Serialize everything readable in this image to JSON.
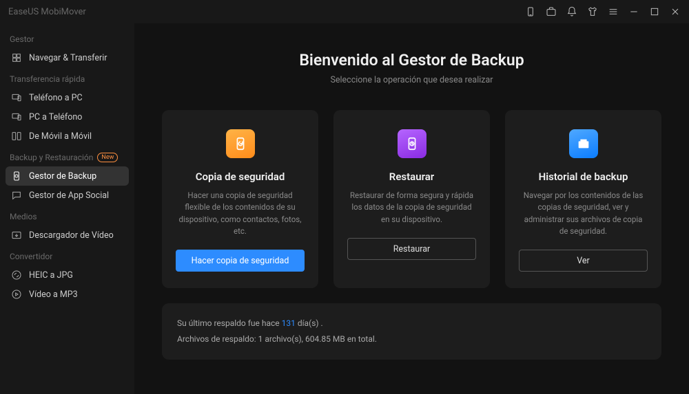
{
  "app": {
    "title": "EaseUS MobiMover"
  },
  "sidebar": {
    "groups": [
      {
        "label": "Gestor",
        "items": [
          {
            "label": "Navegar & Transferir"
          }
        ]
      },
      {
        "label": "Transferencia rápida",
        "items": [
          {
            "label": "Teléfono a PC"
          },
          {
            "label": "PC a Teléfono"
          },
          {
            "label": "De Móvil a Móvil"
          }
        ]
      },
      {
        "label": "Backup y Restauración",
        "badge": "New",
        "items": [
          {
            "label": "Gestor de Backup"
          },
          {
            "label": "Gestor de App Social"
          }
        ]
      },
      {
        "label": "Medios",
        "items": [
          {
            "label": "Descargador de Vídeo"
          }
        ]
      },
      {
        "label": "Convertidor",
        "items": [
          {
            "label": "HEIC a JPG"
          },
          {
            "label": "Vídeo a MP3"
          }
        ]
      }
    ]
  },
  "main": {
    "title": "Bienvenido al Gestor de Backup",
    "subtitle": "Seleccione la operación que desea realizar",
    "cards": [
      {
        "title": "Copia de seguridad",
        "desc": "Hacer una copia de seguridad flexible de los contenidos de su dispositivo, como contactos, fotos, etc.",
        "button": "Hacer copia de seguridad"
      },
      {
        "title": "Restaurar",
        "desc": "Restaurar de forma segura y rápida los datos de la copia de seguridad en su dispositivo.",
        "button": "Restaurar"
      },
      {
        "title": "Historial de backup",
        "desc": "Navegar por los contenidos de las copias de seguridad, ver y administrar sus archivos de copia de seguridad.",
        "button": "Ver"
      }
    ],
    "status": {
      "line1_prefix": "Su último respaldo fue hace ",
      "line1_days": "131",
      "line1_suffix": " día(s) .",
      "line2": "Archivos de respaldo: 1 archivo(s), 604.85 MB en total."
    }
  }
}
